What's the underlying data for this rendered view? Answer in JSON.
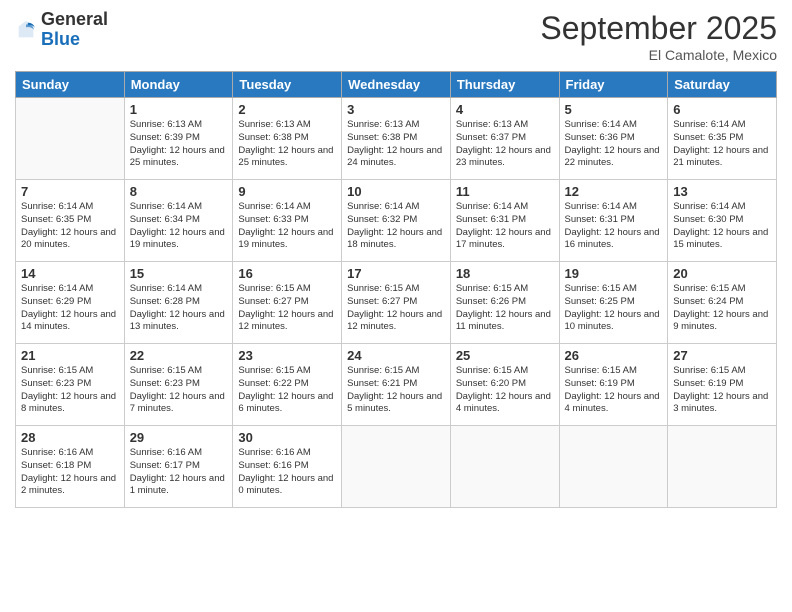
{
  "header": {
    "logo_general": "General",
    "logo_blue": "Blue",
    "month_title": "September 2025",
    "location": "El Camalote, Mexico"
  },
  "days_of_week": [
    "Sunday",
    "Monday",
    "Tuesday",
    "Wednesday",
    "Thursday",
    "Friday",
    "Saturday"
  ],
  "weeks": [
    [
      {
        "day": "",
        "sunrise": "",
        "sunset": "",
        "daylight": ""
      },
      {
        "day": "1",
        "sunrise": "Sunrise: 6:13 AM",
        "sunset": "Sunset: 6:39 PM",
        "daylight": "Daylight: 12 hours and 25 minutes."
      },
      {
        "day": "2",
        "sunrise": "Sunrise: 6:13 AM",
        "sunset": "Sunset: 6:38 PM",
        "daylight": "Daylight: 12 hours and 25 minutes."
      },
      {
        "day": "3",
        "sunrise": "Sunrise: 6:13 AM",
        "sunset": "Sunset: 6:38 PM",
        "daylight": "Daylight: 12 hours and 24 minutes."
      },
      {
        "day": "4",
        "sunrise": "Sunrise: 6:13 AM",
        "sunset": "Sunset: 6:37 PM",
        "daylight": "Daylight: 12 hours and 23 minutes."
      },
      {
        "day": "5",
        "sunrise": "Sunrise: 6:14 AM",
        "sunset": "Sunset: 6:36 PM",
        "daylight": "Daylight: 12 hours and 22 minutes."
      },
      {
        "day": "6",
        "sunrise": "Sunrise: 6:14 AM",
        "sunset": "Sunset: 6:35 PM",
        "daylight": "Daylight: 12 hours and 21 minutes."
      }
    ],
    [
      {
        "day": "7",
        "sunrise": "Sunrise: 6:14 AM",
        "sunset": "Sunset: 6:35 PM",
        "daylight": "Daylight: 12 hours and 20 minutes."
      },
      {
        "day": "8",
        "sunrise": "Sunrise: 6:14 AM",
        "sunset": "Sunset: 6:34 PM",
        "daylight": "Daylight: 12 hours and 19 minutes."
      },
      {
        "day": "9",
        "sunrise": "Sunrise: 6:14 AM",
        "sunset": "Sunset: 6:33 PM",
        "daylight": "Daylight: 12 hours and 19 minutes."
      },
      {
        "day": "10",
        "sunrise": "Sunrise: 6:14 AM",
        "sunset": "Sunset: 6:32 PM",
        "daylight": "Daylight: 12 hours and 18 minutes."
      },
      {
        "day": "11",
        "sunrise": "Sunrise: 6:14 AM",
        "sunset": "Sunset: 6:31 PM",
        "daylight": "Daylight: 12 hours and 17 minutes."
      },
      {
        "day": "12",
        "sunrise": "Sunrise: 6:14 AM",
        "sunset": "Sunset: 6:31 PM",
        "daylight": "Daylight: 12 hours and 16 minutes."
      },
      {
        "day": "13",
        "sunrise": "Sunrise: 6:14 AM",
        "sunset": "Sunset: 6:30 PM",
        "daylight": "Daylight: 12 hours and 15 minutes."
      }
    ],
    [
      {
        "day": "14",
        "sunrise": "Sunrise: 6:14 AM",
        "sunset": "Sunset: 6:29 PM",
        "daylight": "Daylight: 12 hours and 14 minutes."
      },
      {
        "day": "15",
        "sunrise": "Sunrise: 6:14 AM",
        "sunset": "Sunset: 6:28 PM",
        "daylight": "Daylight: 12 hours and 13 minutes."
      },
      {
        "day": "16",
        "sunrise": "Sunrise: 6:15 AM",
        "sunset": "Sunset: 6:27 PM",
        "daylight": "Daylight: 12 hours and 12 minutes."
      },
      {
        "day": "17",
        "sunrise": "Sunrise: 6:15 AM",
        "sunset": "Sunset: 6:27 PM",
        "daylight": "Daylight: 12 hours and 12 minutes."
      },
      {
        "day": "18",
        "sunrise": "Sunrise: 6:15 AM",
        "sunset": "Sunset: 6:26 PM",
        "daylight": "Daylight: 12 hours and 11 minutes."
      },
      {
        "day": "19",
        "sunrise": "Sunrise: 6:15 AM",
        "sunset": "Sunset: 6:25 PM",
        "daylight": "Daylight: 12 hours and 10 minutes."
      },
      {
        "day": "20",
        "sunrise": "Sunrise: 6:15 AM",
        "sunset": "Sunset: 6:24 PM",
        "daylight": "Daylight: 12 hours and 9 minutes."
      }
    ],
    [
      {
        "day": "21",
        "sunrise": "Sunrise: 6:15 AM",
        "sunset": "Sunset: 6:23 PM",
        "daylight": "Daylight: 12 hours and 8 minutes."
      },
      {
        "day": "22",
        "sunrise": "Sunrise: 6:15 AM",
        "sunset": "Sunset: 6:23 PM",
        "daylight": "Daylight: 12 hours and 7 minutes."
      },
      {
        "day": "23",
        "sunrise": "Sunrise: 6:15 AM",
        "sunset": "Sunset: 6:22 PM",
        "daylight": "Daylight: 12 hours and 6 minutes."
      },
      {
        "day": "24",
        "sunrise": "Sunrise: 6:15 AM",
        "sunset": "Sunset: 6:21 PM",
        "daylight": "Daylight: 12 hours and 5 minutes."
      },
      {
        "day": "25",
        "sunrise": "Sunrise: 6:15 AM",
        "sunset": "Sunset: 6:20 PM",
        "daylight": "Daylight: 12 hours and 4 minutes."
      },
      {
        "day": "26",
        "sunrise": "Sunrise: 6:15 AM",
        "sunset": "Sunset: 6:19 PM",
        "daylight": "Daylight: 12 hours and 4 minutes."
      },
      {
        "day": "27",
        "sunrise": "Sunrise: 6:15 AM",
        "sunset": "Sunset: 6:19 PM",
        "daylight": "Daylight: 12 hours and 3 minutes."
      }
    ],
    [
      {
        "day": "28",
        "sunrise": "Sunrise: 6:16 AM",
        "sunset": "Sunset: 6:18 PM",
        "daylight": "Daylight: 12 hours and 2 minutes."
      },
      {
        "day": "29",
        "sunrise": "Sunrise: 6:16 AM",
        "sunset": "Sunset: 6:17 PM",
        "daylight": "Daylight: 12 hours and 1 minute."
      },
      {
        "day": "30",
        "sunrise": "Sunrise: 6:16 AM",
        "sunset": "Sunset: 6:16 PM",
        "daylight": "Daylight: 12 hours and 0 minutes."
      },
      {
        "day": "",
        "sunrise": "",
        "sunset": "",
        "daylight": ""
      },
      {
        "day": "",
        "sunrise": "",
        "sunset": "",
        "daylight": ""
      },
      {
        "day": "",
        "sunrise": "",
        "sunset": "",
        "daylight": ""
      },
      {
        "day": "",
        "sunrise": "",
        "sunset": "",
        "daylight": ""
      }
    ]
  ]
}
